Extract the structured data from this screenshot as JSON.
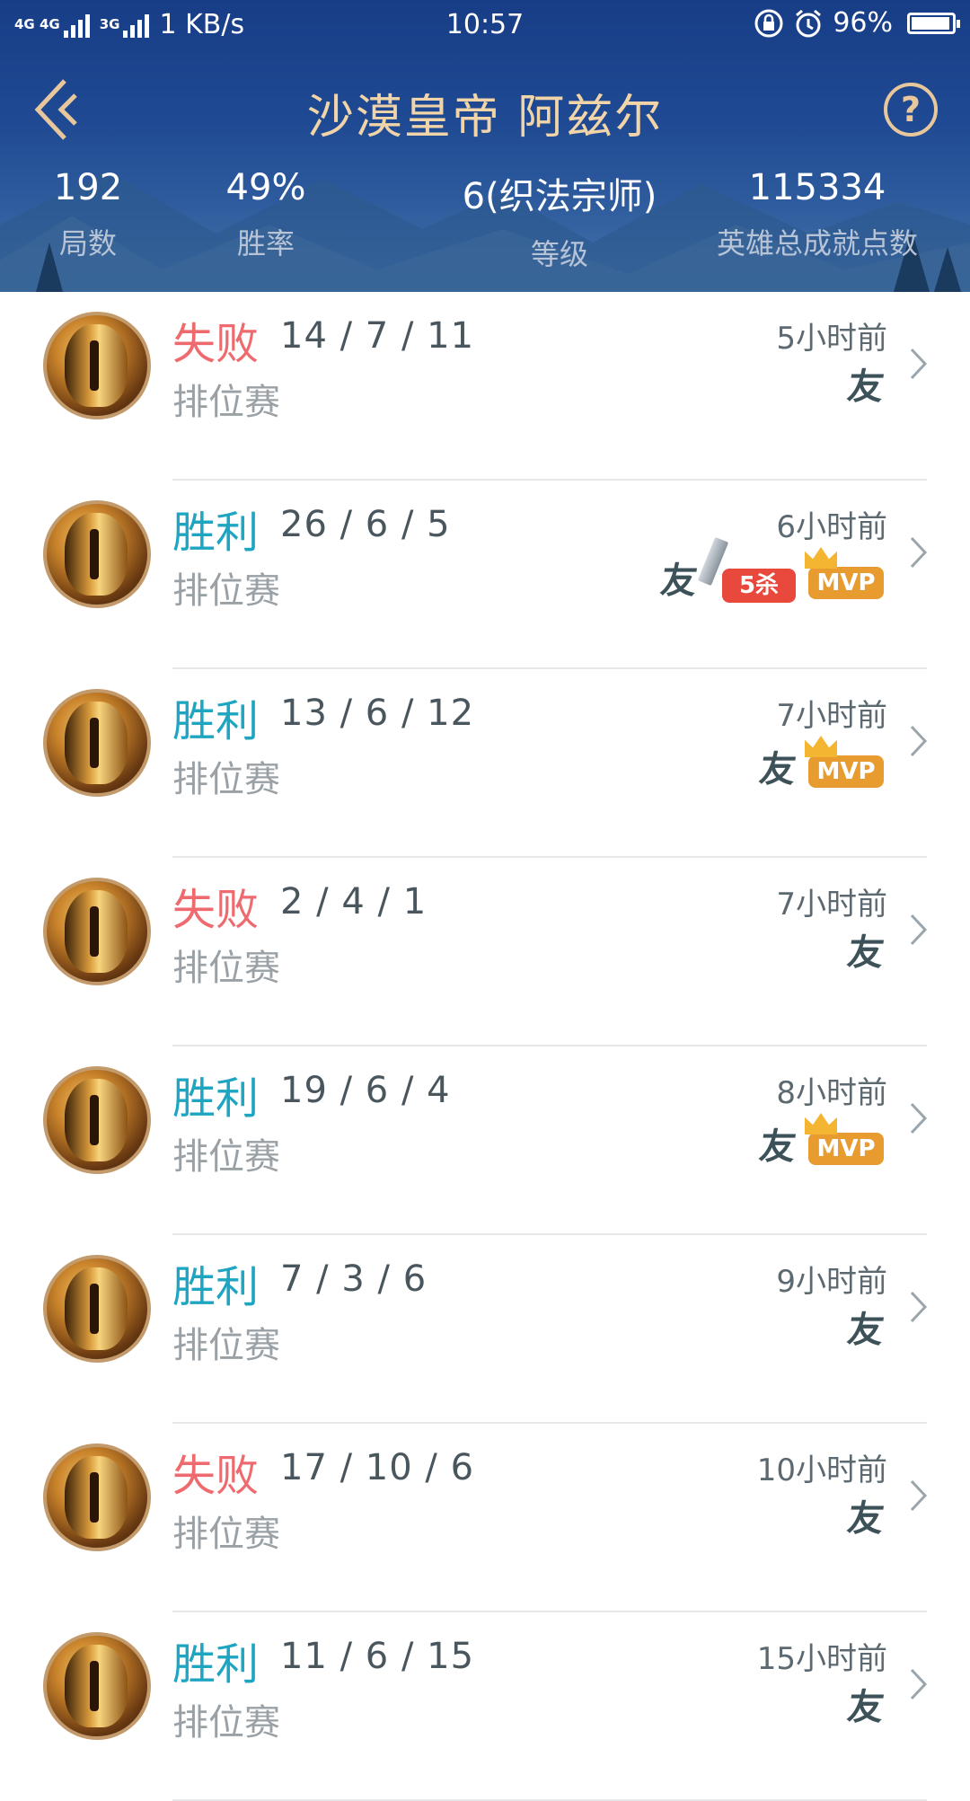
{
  "status_bar": {
    "network_left": "4G 4G",
    "network_right": "3G",
    "speed": "1 KB/s",
    "time": "10:57",
    "battery": "96%",
    "battery_level": 0.96
  },
  "header": {
    "title": "沙漠皇帝 阿兹尔",
    "help_label": "?",
    "stats": [
      {
        "value": "192",
        "label": "局数"
      },
      {
        "value": "49%",
        "label": "胜率"
      },
      {
        "value": "6(织法宗师)",
        "label": "等级"
      },
      {
        "value": "115334",
        "label": "英雄总成就点数"
      }
    ]
  },
  "matches": [
    {
      "result": "失败",
      "outcome": "lose",
      "kda": "14 / 7 / 11",
      "mode": "排位赛",
      "time": "5小时前",
      "friend": "友",
      "five_kill": "",
      "mvp": ""
    },
    {
      "result": "胜利",
      "outcome": "win",
      "kda": "26 / 6 / 5",
      "mode": "排位赛",
      "time": "6小时前",
      "friend": "友",
      "five_kill": "5杀",
      "mvp": "MVP"
    },
    {
      "result": "胜利",
      "outcome": "win",
      "kda": "13 / 6 / 12",
      "mode": "排位赛",
      "time": "7小时前",
      "friend": "友",
      "five_kill": "",
      "mvp": "MVP"
    },
    {
      "result": "失败",
      "outcome": "lose",
      "kda": "2 / 4 / 1",
      "mode": "排位赛",
      "time": "7小时前",
      "friend": "友",
      "five_kill": "",
      "mvp": ""
    },
    {
      "result": "胜利",
      "outcome": "win",
      "kda": "19 / 6 / 4",
      "mode": "排位赛",
      "time": "8小时前",
      "friend": "友",
      "five_kill": "",
      "mvp": "MVP"
    },
    {
      "result": "胜利",
      "outcome": "win",
      "kda": "7 / 3 / 6",
      "mode": "排位赛",
      "time": "9小时前",
      "friend": "友",
      "five_kill": "",
      "mvp": ""
    },
    {
      "result": "失败",
      "outcome": "lose",
      "kda": "17 / 10 / 6",
      "mode": "排位赛",
      "time": "10小时前",
      "friend": "友",
      "five_kill": "",
      "mvp": ""
    },
    {
      "result": "胜利",
      "outcome": "win",
      "kda": "11 / 6 / 15",
      "mode": "排位赛",
      "time": "15小时前",
      "friend": "友",
      "five_kill": "",
      "mvp": ""
    }
  ],
  "colors": {
    "win": "#1ea5c2",
    "lose": "#ef6a6e",
    "title": "#f1d4a8",
    "header_bg": "#1f4a93"
  },
  "icons": {
    "back": "chevron-left-icon",
    "help": "question-circle-icon",
    "row_arrow": "chevron-right-icon",
    "friend": "friend-icon",
    "five_kill": "sword-icon",
    "mvp": "crown-icon"
  }
}
